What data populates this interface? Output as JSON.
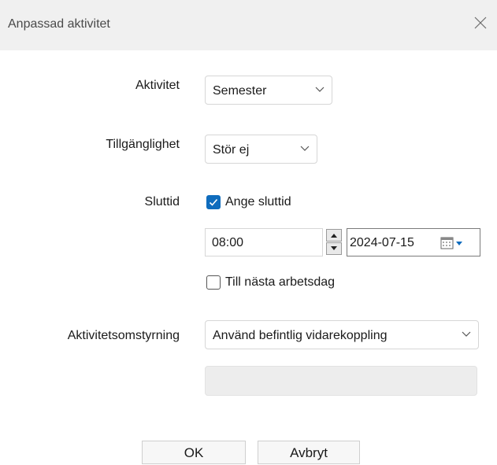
{
  "dialog": {
    "title": "Anpassad aktivitet"
  },
  "form": {
    "aktivitet": {
      "label": "Aktivitet",
      "value": "Semester"
    },
    "tillganglighet": {
      "label": "Tillgänglighet",
      "value": "Stör ej"
    },
    "sluttid": {
      "label": "Sluttid",
      "set_end_time": {
        "label": "Ange sluttid",
        "checked": true
      },
      "time": "08:00",
      "date": "2024-07-15",
      "next_workday": {
        "label": "Till nästa arbetsdag",
        "checked": false
      }
    },
    "omstyrning": {
      "label": "Aktivitetsomstyrning",
      "value": "Använd befintlig vidarekoppling",
      "extra_field": ""
    }
  },
  "buttons": {
    "ok": "OK",
    "cancel": "Avbryt"
  },
  "colors": {
    "accent": "#0f6cbd",
    "titlebar": "#f0f0f0"
  },
  "icons": [
    "close-icon",
    "chevron-down-icon",
    "checkmark-icon",
    "spin-up-icon",
    "spin-down-icon",
    "calendar-icon"
  ]
}
